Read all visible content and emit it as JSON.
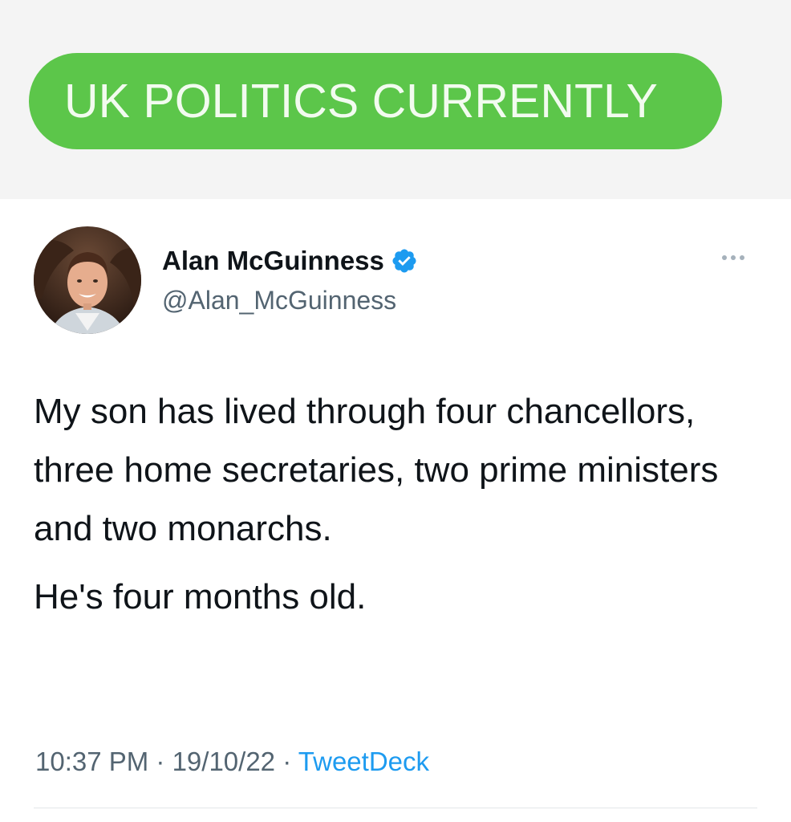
{
  "banner": {
    "text": "UK POLITICS CURRENTLY",
    "color": "#5cc64a"
  },
  "tweet": {
    "author": {
      "display_name": "Alan McGuinness",
      "handle": "@Alan_McGuinness",
      "verified": true
    },
    "more_icon": "more-horizontal-icon",
    "verified_icon": "verified-badge-icon",
    "body": {
      "paragraph1": "My son has lived through four chancellors, three home secretaries, two prime ministers and two monarchs.",
      "paragraph2": "He's four months old."
    },
    "meta": {
      "time": "10:37 PM",
      "separator1": " · ",
      "date": "19/10/22",
      "separator2": " · ",
      "source": "TweetDeck"
    },
    "accent_color": "#1d9bf0"
  }
}
